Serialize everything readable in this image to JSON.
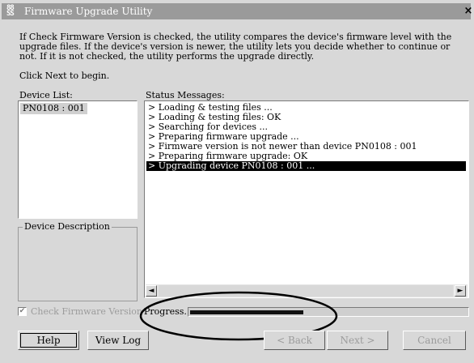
{
  "window": {
    "title": "Firmware Upgrade Utility",
    "icon_text": "88\nSS",
    "close_glyph": "×"
  },
  "info": {
    "text": "If Check Firmware Version is checked, the utility compares the device's firmware level with the upgrade files. If the device's version is newer, the utility lets you decide whether to continue or not. If it is not checked, the utility performs the upgrade directly.",
    "prompt": "Click Next to begin."
  },
  "device_list": {
    "label": "Device List:",
    "items": [
      "PN0108 : 001"
    ]
  },
  "device_description": {
    "label": "Device Description"
  },
  "status": {
    "label": "Status Messages:",
    "messages": [
      "> Loading & testing files ...",
      "> Loading & testing files: OK",
      "> Searching for devices ...",
      "> Preparing firmware upgrade ...",
      "> Firmware version is not newer than device PN0108 : 001",
      "> Preparing firmware upgrade: OK",
      "> Upgrading device PN0108 : 001 ..."
    ],
    "selected_index": 6
  },
  "scrollbar": {
    "left_glyph": "◄",
    "right_glyph": "►"
  },
  "options": {
    "check_firmware_label": "Check Firmware Version",
    "check_firmware_checked": true,
    "checkmark_glyph": "✔"
  },
  "progress": {
    "label": "Progress...",
    "fraction": 0.41
  },
  "buttons": {
    "help": "Help",
    "view_log": "View Log",
    "back": "< Back",
    "next": "Next >",
    "cancel": "Cancel"
  },
  "colors": {
    "window_bg": "#d8d8d8",
    "titlebar": "#9a9a9a",
    "selection": "#000000",
    "annotation_ellipse": "#000000"
  }
}
